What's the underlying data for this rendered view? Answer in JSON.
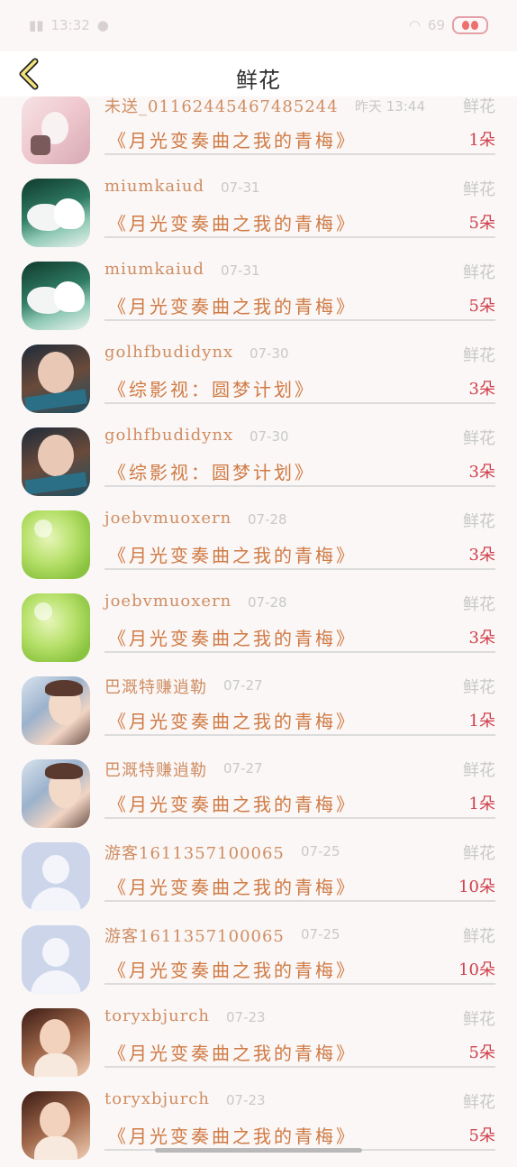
{
  "status": {
    "time": "13:32",
    "battery": "69"
  },
  "header": {
    "title": "鲜花",
    "back_icon": "chevron-left-icon"
  },
  "gift_label": "鲜花",
  "rows": [
    {
      "user": "未送_01162445467485244",
      "date": "昨天 13:44",
      "novel": "《月光变奏曲之我的青梅》",
      "amount": "1朵",
      "avatar": "anime"
    },
    {
      "user": "miumkaiud",
      "date": "07-31",
      "novel": "《月光变奏曲之我的青梅》",
      "amount": "5朵",
      "avatar": "dove"
    },
    {
      "user": "miumkaiud",
      "date": "07-31",
      "novel": "《月光变奏曲之我的青梅》",
      "amount": "5朵",
      "avatar": "dove"
    },
    {
      "user": "golhfbudidynx",
      "date": "07-30",
      "novel": "《综影视：圆梦计划》",
      "amount": "3朵",
      "avatar": "girl"
    },
    {
      "user": "golhfbudidynx",
      "date": "07-30",
      "novel": "《综影视：圆梦计划》",
      "amount": "3朵",
      "avatar": "girl"
    },
    {
      "user": "joebvmuoxern",
      "date": "07-28",
      "novel": "《月光变奏曲之我的青梅》",
      "amount": "3朵",
      "avatar": "green"
    },
    {
      "user": "joebvmuoxern",
      "date": "07-28",
      "novel": "《月光变奏曲之我的青梅》",
      "amount": "3朵",
      "avatar": "green"
    },
    {
      "user": "巴溉特赚逍勒",
      "date": "07-27",
      "novel": "《月光变奏曲之我的青梅》",
      "amount": "1朵",
      "avatar": "man"
    },
    {
      "user": "巴溉特赚逍勒",
      "date": "07-27",
      "novel": "《月光变奏曲之我的青梅》",
      "amount": "1朵",
      "avatar": "man"
    },
    {
      "user": "游客1611357100065",
      "date": "07-25",
      "novel": "《月光变奏曲之我的青梅》",
      "amount": "10朵",
      "avatar": "guest"
    },
    {
      "user": "游客1611357100065",
      "date": "07-25",
      "novel": "《月光变奏曲之我的青梅》",
      "amount": "10朵",
      "avatar": "guest"
    },
    {
      "user": "toryxbjurch",
      "date": "07-23",
      "novel": "《月光变奏曲之我的青梅》",
      "amount": "5朵",
      "avatar": "woman"
    },
    {
      "user": "toryxbjurch",
      "date": "07-23",
      "novel": "《月光变奏曲之我的青梅》",
      "amount": "5朵",
      "avatar": "woman"
    }
  ]
}
